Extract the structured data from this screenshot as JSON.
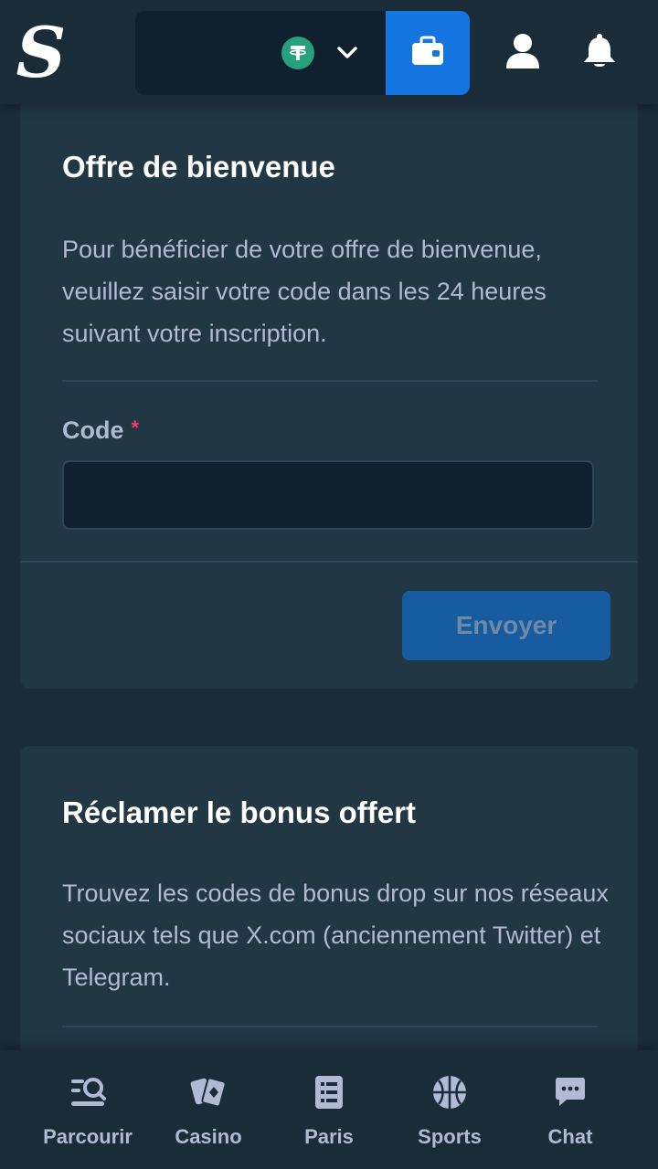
{
  "header": {
    "logo_letter": "S",
    "currency_icon": "tether-icon",
    "colors": {
      "accent": "#1475e1",
      "background": "#1a2c38",
      "card": "#213743",
      "input": "#0f212e",
      "coin": "#26a17b"
    }
  },
  "welcome_offer": {
    "title": "Offre de bienvenue",
    "description": "Pour bénéficier de votre offre de bienvenue, veuillez saisir votre code dans les 24 heures suivant votre inscription.",
    "code_label": "Code",
    "required_mark": "*",
    "code_value": "",
    "submit_label": "Envoyer"
  },
  "claim_bonus": {
    "title": "Réclamer le bonus offert",
    "description": "Trouvez les codes de bonus drop sur nos réseaux sociaux tels que X.com (anciennement Twitter) et Telegram."
  },
  "bottom_nav": {
    "items": [
      {
        "label": "Parcourir",
        "icon": "browse-icon"
      },
      {
        "label": "Casino",
        "icon": "cards-icon"
      },
      {
        "label": "Paris",
        "icon": "betslip-icon"
      },
      {
        "label": "Sports",
        "icon": "basketball-icon"
      },
      {
        "label": "Chat",
        "icon": "chat-icon"
      }
    ]
  }
}
